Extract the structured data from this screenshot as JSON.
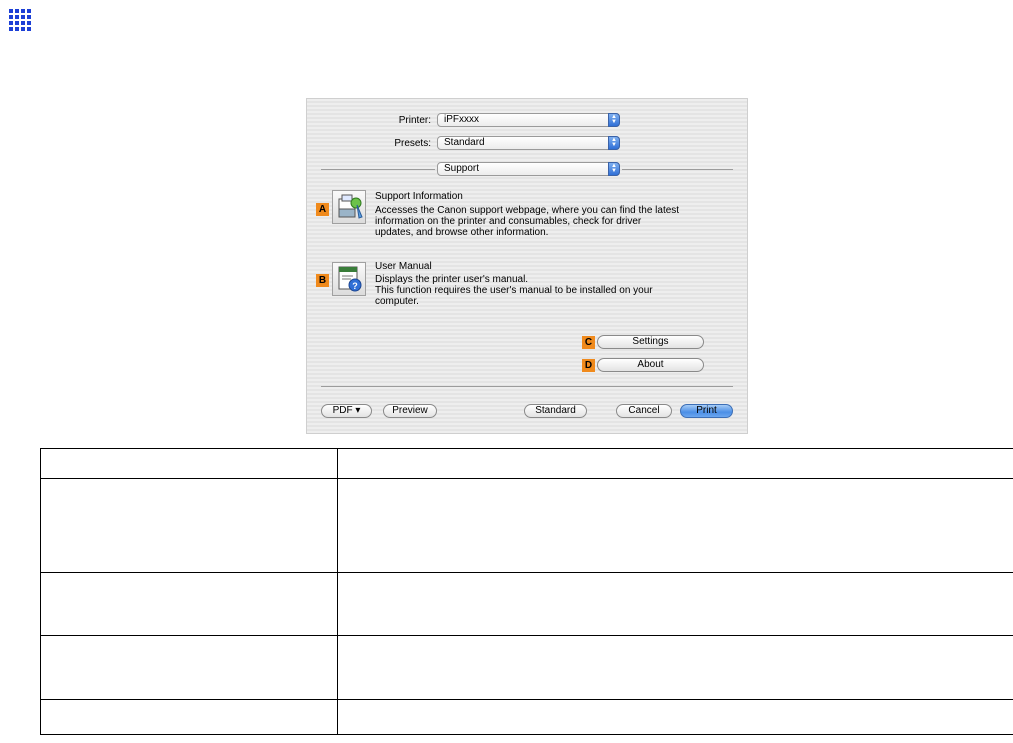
{
  "page_marker_icon": "grid-icon",
  "dialog": {
    "printer": {
      "label": "Printer:",
      "value": "iPFxxxx"
    },
    "presets": {
      "label": "Presets:",
      "value": "Standard"
    },
    "panel": {
      "value": "Support"
    },
    "support_info": {
      "badge": "A",
      "title": "Support Information",
      "lines": [
        "Accesses the Canon support webpage, where you can find the latest",
        "information on the printer and consumables, check for driver",
        "updates, and browse other information."
      ]
    },
    "user_manual": {
      "badge": "B",
      "title": "User Manual",
      "lines": [
        "Displays the printer user's manual.",
        "This function requires the user's manual to be installed on your",
        "computer."
      ]
    },
    "settings": {
      "badge": "C",
      "label": "Settings"
    },
    "about": {
      "badge": "D",
      "label": "About"
    },
    "footer": {
      "pdf": "PDF ▾",
      "preview": "Preview",
      "standard": "Standard",
      "cancel": "Cancel",
      "print": "Print"
    },
    "colors": {
      "badge": "#f08a1c",
      "default_button": "#4c8fe6"
    }
  },
  "table": {
    "rows": [
      [
        "",
        ""
      ],
      [
        "",
        ""
      ],
      [
        "",
        ""
      ],
      [
        "",
        ""
      ],
      [
        "",
        ""
      ]
    ]
  }
}
